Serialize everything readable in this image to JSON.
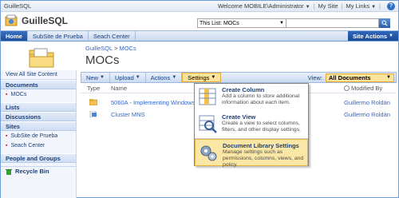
{
  "global": {
    "site_name": "GuilleSQL",
    "welcome": "Welcome MOBILE\\Administrator",
    "my_site": "My Site",
    "my_links": "My Links",
    "help_icon": "question-icon"
  },
  "title": {
    "site_title": "GuilleSQL",
    "search_scope": "This List: MOCs",
    "search_value": ""
  },
  "nav": {
    "tabs": [
      "Home",
      "SubSite de Prueba",
      "Seach Center"
    ],
    "site_actions": "Site Actions"
  },
  "page": {
    "breadcrumb_site": "GuilleSQL",
    "breadcrumb_sep": " > ",
    "breadcrumb_current": "MOCs",
    "title": "MOCs"
  },
  "leftnav": {
    "view_all": "View All Site Content",
    "documents_head": "Documents",
    "documents_items": [
      "MOCs"
    ],
    "lists_head": "Lists",
    "discussions_head": "Discussions",
    "sites_head": "Sites",
    "sites_items": [
      "SubSite de Prueba",
      "Seach Center"
    ],
    "people_head": "People and Groups",
    "recycle_bin": "Recycle Bin"
  },
  "toolbar": {
    "new": "New",
    "upload": "Upload",
    "actions": "Actions",
    "settings": "Settings",
    "view_label": "View:",
    "view_value": "All Documents"
  },
  "list": {
    "headers": {
      "type": "Type",
      "name": "Name",
      "modified_by": "Modified By"
    },
    "rows": [
      {
        "name": "5060A - Implementing Windows",
        "modified_by": "Guillermo Roldán",
        "icon": "folder-icon"
      },
      {
        "name": "Cluster MNS",
        "modified_by": "Guillermo Roldán",
        "icon": "document-icon"
      }
    ]
  },
  "menu": {
    "items": [
      {
        "title": "Create Column",
        "desc": "Add a column to store additional information about each item."
      },
      {
        "title": "Create View",
        "desc": "Create a view to select columns, filters, and other display settings."
      },
      {
        "title": "Document Library Settings",
        "desc": "Manage settings such as permissions, columns, views, and policy."
      }
    ]
  },
  "colors": {
    "accent": "#2a5ea8",
    "highlight": "#fbe39c"
  }
}
